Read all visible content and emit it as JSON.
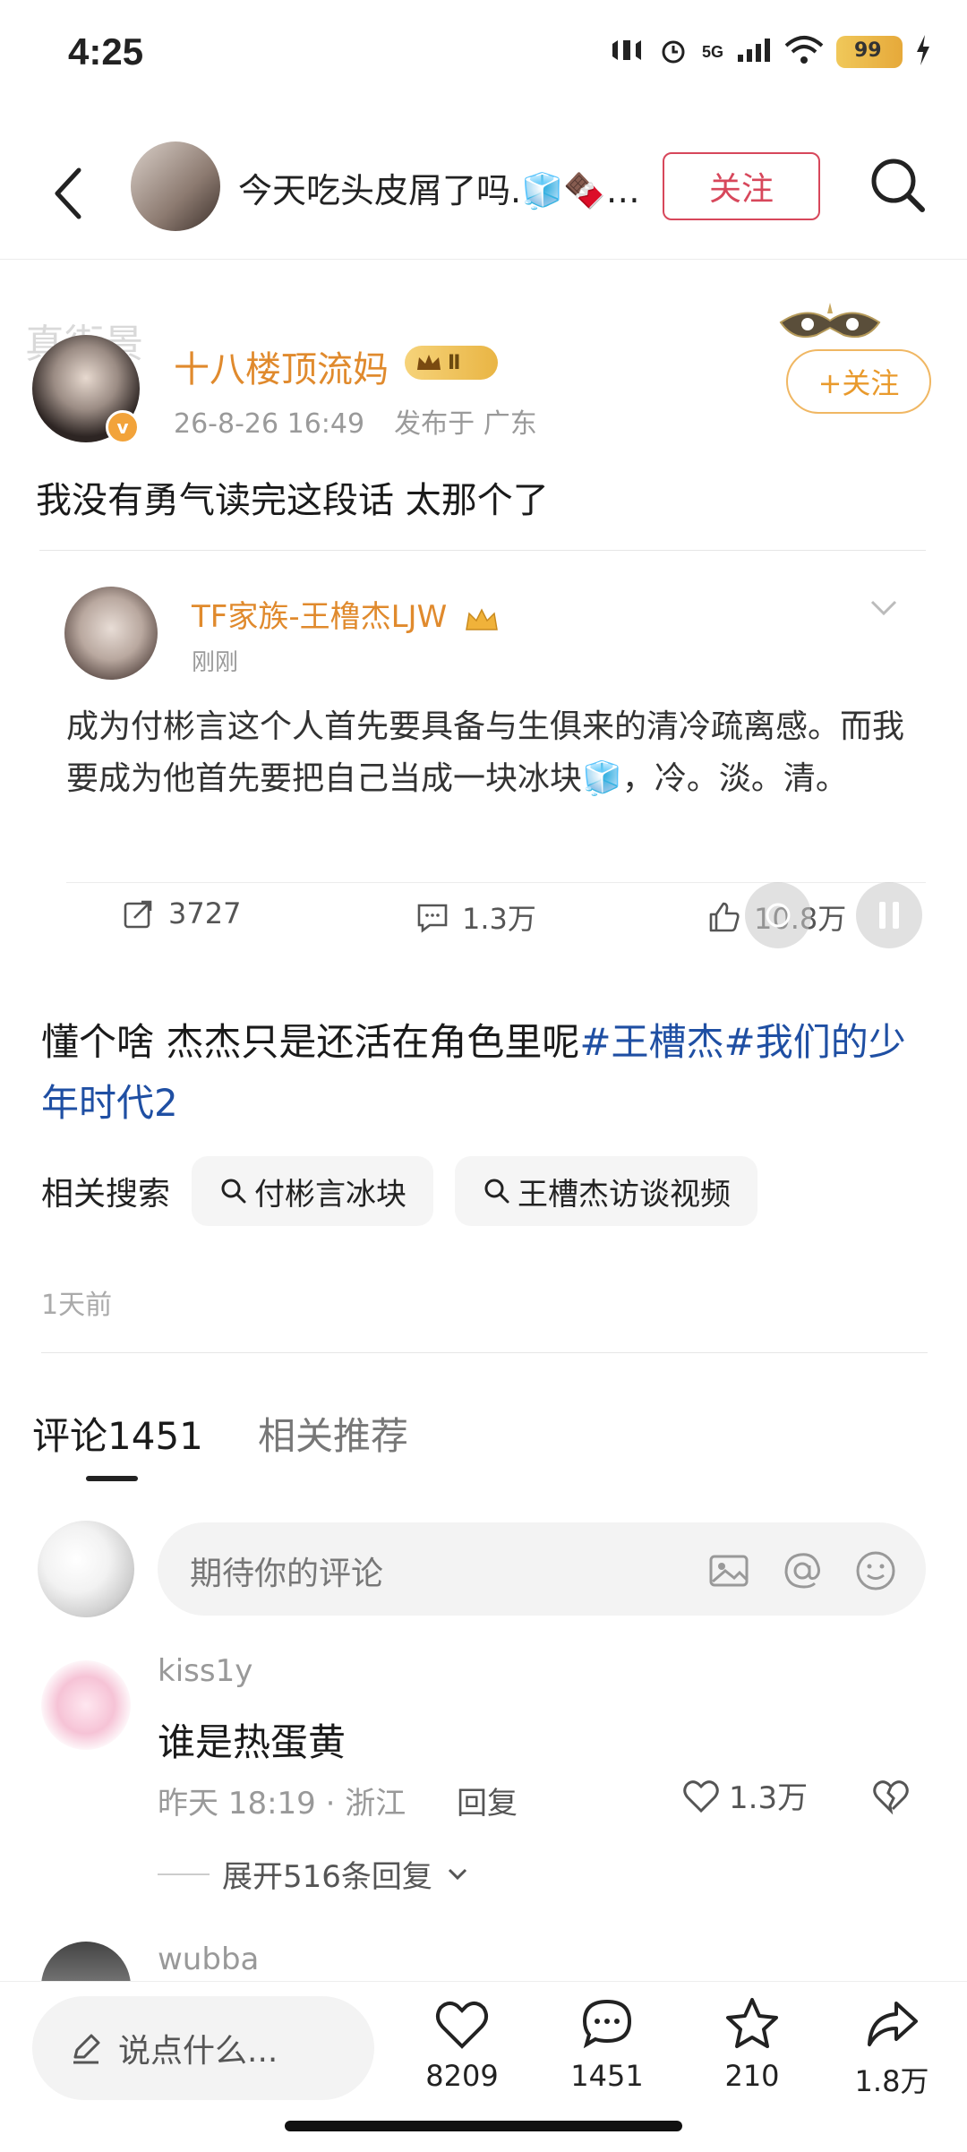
{
  "status_bar": {
    "time": "4:25",
    "network": "5G",
    "battery": "99"
  },
  "nav": {
    "title": "今天吃头皮屑了吗.🧊🍫…",
    "follow_label": "关注"
  },
  "post": {
    "watermark": "真街景",
    "author": "十八楼顶流妈",
    "vip_level": "Ⅱ",
    "verified_mark": "v",
    "date": "26-8-26 16:49",
    "location": "发布于 广东",
    "follow_label": "+关注",
    "text": "我没有勇气读完这段话 太那个了"
  },
  "quote": {
    "author": "TF家族-王橹杰LJW",
    "time": "刚刚",
    "text": "成为付彬言这个人首先要具备与生俱来的清冷疏离感。而我要成为他首先要把自己当成一块冰块🧊，冷。淡。清。",
    "reposts": "3727",
    "comments": "1.3万",
    "likes": "10.8万"
  },
  "body": {
    "text": "懂个啥 杰杰只是还活在角色里呢",
    "topic1": "#王槽杰#",
    "topic2": "我们的少年时代2"
  },
  "related": {
    "label": "相关搜索",
    "chips": [
      "付彬言冰块",
      "王槽杰访谈视频"
    ]
  },
  "post_age": "1天前",
  "tabs": {
    "comments": "评论1451",
    "recommend": "相关推荐"
  },
  "comment_input": {
    "placeholder": "期待你的评论"
  },
  "comments": [
    {
      "user": "kiss1y",
      "text": "谁是热蛋黄",
      "meta": "昨天 18:19 · 浙江",
      "reply": "回复",
      "likes": "1.3万",
      "expand": "展开516条回复"
    },
    {
      "user": "wubba"
    }
  ],
  "bottom": {
    "say_placeholder": "说点什么...",
    "likes": "8209",
    "comments": "1451",
    "favorites": "210",
    "shares": "1.8万"
  }
}
